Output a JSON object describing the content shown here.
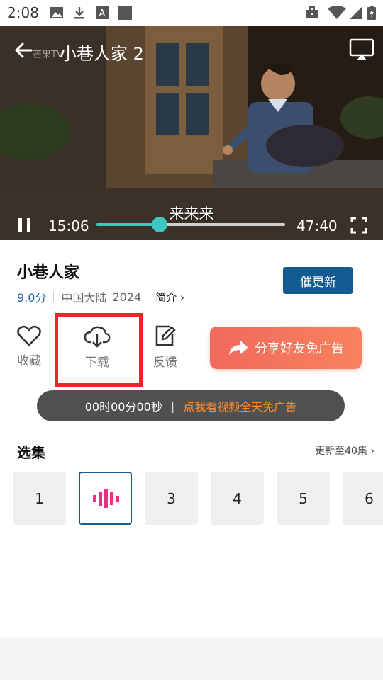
{
  "status_bar": {
    "time": "2:08"
  },
  "player": {
    "title": "小巷人家 2",
    "watermark": "芒果TV",
    "subtitle": "来来来",
    "current_time": "15:06",
    "total_time": "47:40",
    "progress": 0.335
  },
  "show": {
    "title": "小巷人家",
    "score": "9.0分",
    "region": "中国大陆",
    "year": "2024",
    "intro_label": "简介",
    "urge_button": "催更新"
  },
  "actions": {
    "favorite": "收藏",
    "download": "下载",
    "feedback": "反馈",
    "share_banner": "分享好友免广告"
  },
  "timer_bar": {
    "countdown": "00时00分00秒",
    "divider": "|",
    "cta": "点我看视频全天免广告"
  },
  "episodes": {
    "title": "选集",
    "update_label": "更新至40集",
    "items": [
      "1",
      "2",
      "3",
      "4",
      "5",
      "6"
    ],
    "active_index": 1
  },
  "colors": {
    "accent_blue": "#125b91",
    "progress_teal": "#3cc7c0",
    "highlight_red": "#f3232b",
    "ad_orange": "#ff8c2c"
  }
}
